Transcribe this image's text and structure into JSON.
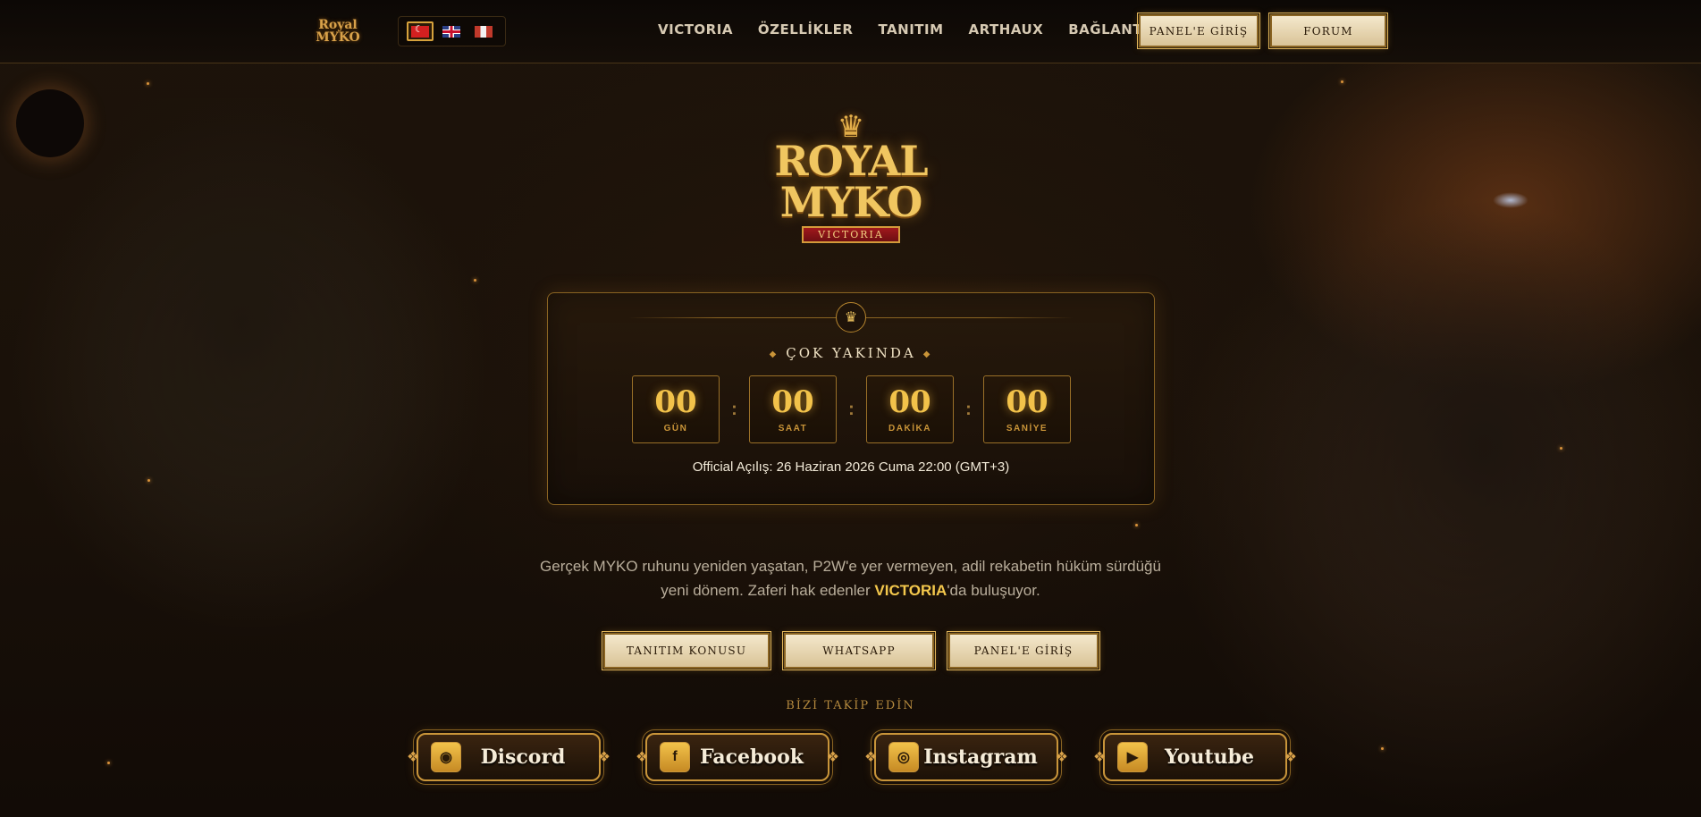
{
  "header": {
    "brand": {
      "line1": "Royal",
      "line2": "MYKO"
    },
    "languages": [
      {
        "code": "tr",
        "icon": "turkish-flag-icon",
        "active": true
      },
      {
        "code": "en",
        "icon": "uk-flag-icon",
        "active": false
      },
      {
        "code": "other",
        "icon": "red-white-flag-icon",
        "active": false
      }
    ],
    "nav": [
      "VICTORIA",
      "ÖZELLİKLER",
      "TANITIM",
      "ARTHAUX",
      "BAĞLANTILAR"
    ],
    "panel_login_label": "PANEL'E GİRİŞ",
    "forum_label": "FORUM"
  },
  "hero": {
    "logo_line1": "ROYAL",
    "logo_line2": "MYKO",
    "logo_ribbon": "VICTORIA"
  },
  "countdown": {
    "heading": "ÇOK YAKINDA",
    "units": [
      {
        "value": "00",
        "label": "GÜN"
      },
      {
        "value": "00",
        "label": "SAAT"
      },
      {
        "value": "00",
        "label": "DAKİKA"
      },
      {
        "value": "00",
        "label": "SANİYE"
      }
    ],
    "official": "Official Açılış: 26 Haziran 2026 Cuma 22:00 (GMT+3)"
  },
  "description": {
    "before": "Gerçek MYKO ruhunu yeniden yaşatan, P2W'e yer vermeyen, adil rekabetin hüküm sürdüğü yeni dönem. Zaferi hak edenler ",
    "highlight": "VICTORIA",
    "after": "'da buluşuyor."
  },
  "cta": [
    "TANITIM KONUSU",
    "WHATSAPP",
    "PANEL'E GİRİŞ"
  ],
  "follow_label": "BİZİ TAKİP EDİN",
  "socials": [
    {
      "name": "Discord",
      "icon": "discord-icon"
    },
    {
      "name": "Facebook",
      "icon": "facebook-icon"
    },
    {
      "name": "Instagram",
      "icon": "instagram-icon"
    },
    {
      "name": "Youtube",
      "icon": "youtube-icon"
    }
  ],
  "colors": {
    "accent_gold": "#f2c24a",
    "border_gold": "#8a6422",
    "background": "#140d07"
  }
}
